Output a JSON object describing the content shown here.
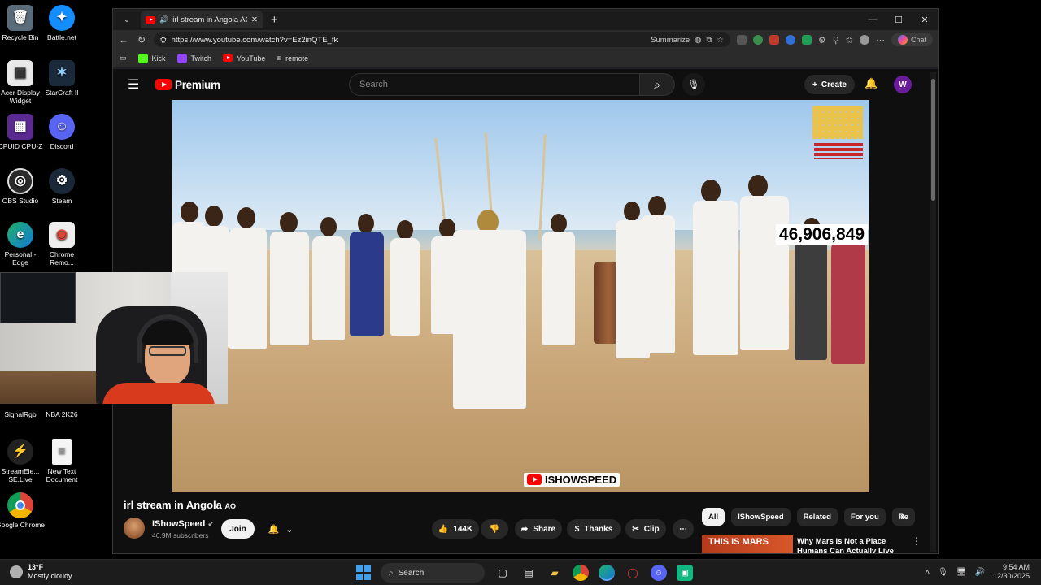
{
  "desktop": {
    "icons": [
      {
        "label": "Recycle Bin",
        "icon": "recycle-bin-icon"
      },
      {
        "label": "Battle.net",
        "icon": "battlenet-icon"
      },
      {
        "label": "Acer Display Widget",
        "icon": "acer-icon"
      },
      {
        "label": "StarCraft II",
        "icon": "starcraft-icon"
      },
      {
        "label": "CPUID CPU-Z",
        "icon": "cpuz-icon"
      },
      {
        "label": "Discord",
        "icon": "discord-icon"
      },
      {
        "label": "OBS Studio",
        "icon": "obs-icon"
      },
      {
        "label": "Steam",
        "icon": "steam-icon"
      },
      {
        "label": "Personal - Edge",
        "icon": "edge-icon"
      },
      {
        "label": "Chrome Remo...",
        "icon": "chrome-remote-icon"
      },
      {
        "label": "SignalRgb",
        "icon": "signalrgb-icon"
      },
      {
        "label": "NBA 2K26",
        "icon": "nba-icon"
      },
      {
        "label": "StreamEle... SE.Live",
        "icon": "streamelements-icon"
      },
      {
        "label": "New Text Document",
        "icon": "text-document-icon"
      },
      {
        "label": "Google Chrome",
        "icon": "chrome-icon"
      }
    ]
  },
  "browser": {
    "tab_title": "irl stream in Angola AO - YouT",
    "url": "https://www.youtube.com/watch?v=Ez2inQTE_fk",
    "summarize_label": "Summarize",
    "chat_label": "Chat",
    "bookmarks": [
      "Kick",
      "Twitch",
      "YouTube",
      "remote"
    ]
  },
  "youtube": {
    "logo_text": "Premium",
    "search_placeholder": "Search",
    "create_label": "Create",
    "avatar_letter": "W",
    "video": {
      "counter": "46,906,849",
      "watermark": "ISHOWSPEED"
    },
    "title": "irl stream in Angola",
    "title_flag": "AO",
    "channel": {
      "name": "IShowSpeed",
      "subscribers": "46.9M subscribers",
      "join_label": "Join"
    },
    "actions": {
      "likes": "144K",
      "share": "Share",
      "thanks": "Thanks",
      "clip": "Clip"
    },
    "chips": [
      "All",
      "IShowSpeed",
      "Related",
      "For you",
      "Re"
    ],
    "recommendation": {
      "thumb_text": "THIS IS MARS",
      "title": "Why Mars Is Not a Place Humans Can Actually Live"
    }
  },
  "taskbar": {
    "temperature": "13°F",
    "weather": "Mostly cloudy",
    "search_label": "Search",
    "time": "9:54 AM",
    "date": "12/30/2025"
  },
  "colors": {
    "youtube_red": "#ff0000",
    "page_bg": "#0f0f0f",
    "chip_bg": "#272727"
  }
}
